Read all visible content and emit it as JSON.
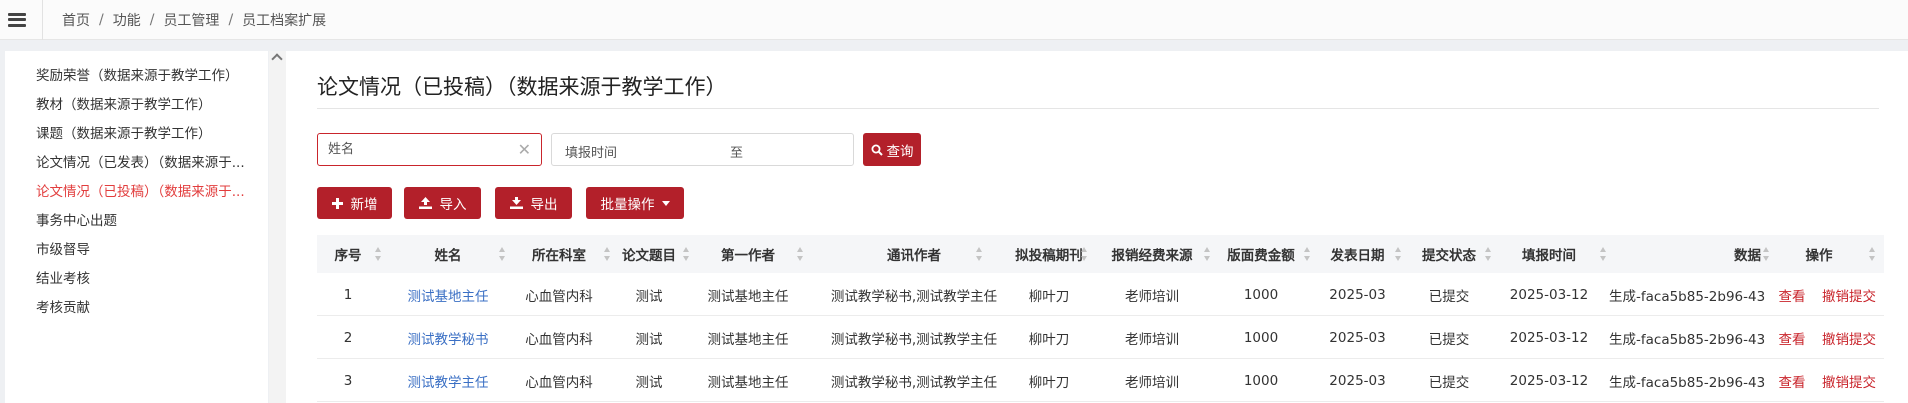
{
  "breadcrumb": [
    "首页",
    "功能",
    "员工管理",
    "员工档案扩展"
  ],
  "sidebar": {
    "items": [
      {
        "label": "奖励荣誉（数据来源于教学工作）",
        "active": false
      },
      {
        "label": "教材（数据来源于教学工作）",
        "active": false
      },
      {
        "label": "课题（数据来源于教学工作）",
        "active": false
      },
      {
        "label": "论文情况（已发表）（数据来源于...",
        "active": false
      },
      {
        "label": "论文情况（已投稿）（数据来源于...",
        "active": true
      },
      {
        "label": "事务中心出题",
        "active": false
      },
      {
        "label": "市级督导",
        "active": false
      },
      {
        "label": "结业考核",
        "active": false
      },
      {
        "label": "考核贡献",
        "active": false
      }
    ]
  },
  "main": {
    "title": "论文情况（已投稿）（数据来源于教学工作）",
    "search": {
      "name_placeholder": "姓名",
      "date_label": "填报时间",
      "date_to": "至",
      "query_label": "查询"
    },
    "toolbar": {
      "add_label": "新增",
      "import_label": "导入",
      "export_label": "导出",
      "batch_label": "批量操作"
    },
    "table": {
      "columns": [
        "序号",
        "姓名",
        "所在科室",
        "论文题目",
        "第一作者",
        "通讯作者",
        "拟投稿期刊",
        "报销经费来源",
        "版面费金额",
        "发表日期",
        "提交状态",
        "填报时间",
        "数据",
        "操作"
      ],
      "rows": [
        {
          "index": "1",
          "name": "测试基地主任",
          "dept": "心血管内科",
          "title": "测试",
          "first_author": "测试基地主任",
          "corresponding": "测试教学秘书,测试教学主任",
          "journal": "柳叶刀",
          "funding": "老师培训",
          "fee": "1000",
          "pub_date": "2025-03",
          "status": "已提交",
          "fill_date": "2025-03-12",
          "data": "生成-faca5b85-2b96-43",
          "view": "查看",
          "revoke": "撤销提交"
        },
        {
          "index": "2",
          "name": "测试教学秘书",
          "dept": "心血管内科",
          "title": "测试",
          "first_author": "测试基地主任",
          "corresponding": "测试教学秘书,测试教学主任",
          "journal": "柳叶刀",
          "funding": "老师培训",
          "fee": "1000",
          "pub_date": "2025-03",
          "status": "已提交",
          "fill_date": "2025-03-12",
          "data": "生成-faca5b85-2b96-43",
          "view": "查看",
          "revoke": "撤销提交"
        },
        {
          "index": "3",
          "name": "测试教学主任",
          "dept": "心血管内科",
          "title": "测试",
          "first_author": "测试基地主任",
          "corresponding": "测试教学秘书,测试教学主任",
          "journal": "柳叶刀",
          "funding": "老师培训",
          "fee": "1000",
          "pub_date": "2025-03",
          "status": "已提交",
          "fill_date": "2025-03-12",
          "data": "生成-faca5b85-2b96-43",
          "view": "查看",
          "revoke": "撤销提交"
        }
      ]
    }
  },
  "colors": {
    "brand": "#b3202a",
    "active": "#e23d3d",
    "link": "#3a6fc4"
  }
}
